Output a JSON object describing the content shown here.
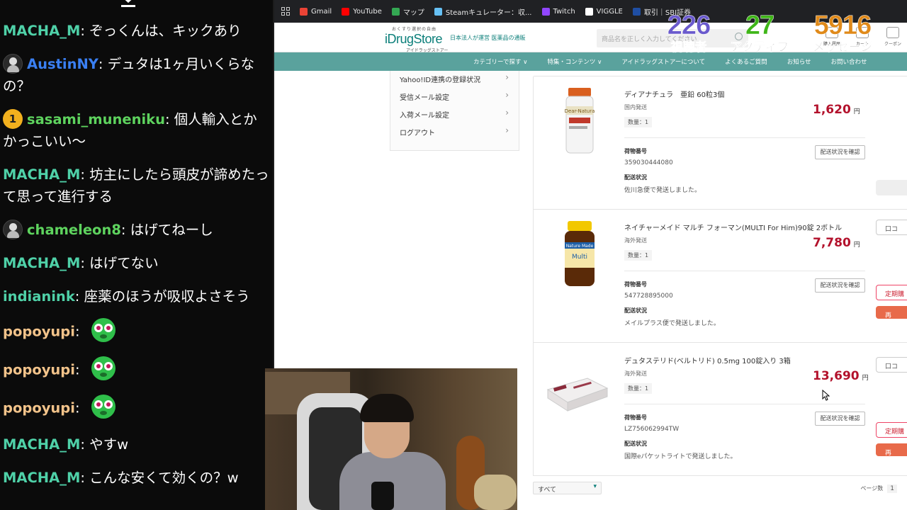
{
  "chat": {
    "messages": [
      {
        "user": "MACHA_M",
        "user_color": "#4fd1a8",
        "badge": "none",
        "text": "ぞっくんは、キックあり"
      },
      {
        "user": "AustinNY",
        "user_color": "#3a7ff2",
        "badge": "avatar",
        "text": "デュタは1ヶ月いくらなの？"
      },
      {
        "user": "sasami_muneniku",
        "user_color": "#5ed35e",
        "badge": "1",
        "text": "個人輸入とかかっこいい〜"
      },
      {
        "user": "MACHA_M",
        "user_color": "#4fd1a8",
        "badge": "none",
        "text": "坊主にしたら頭皮が諦めたって思って進行する"
      },
      {
        "user": "chameleon8",
        "user_color": "#5ed35e",
        "badge": "avatar",
        "text": "はげてねーし"
      },
      {
        "user": "MACHA_M",
        "user_color": "#4fd1a8",
        "badge": "none",
        "text": "はげてない"
      },
      {
        "user": "indianink",
        "user_color": "#4fd1a8",
        "badge": "none",
        "text": "座薬のほうが吸収よさそう"
      },
      {
        "user": "popoyupi",
        "user_color": "#f2c38a",
        "badge": "none",
        "text": "",
        "emote": "green-face-emote"
      },
      {
        "user": "popoyupi",
        "user_color": "#f2c38a",
        "badge": "none",
        "text": "",
        "emote": "green-face-emote"
      },
      {
        "user": "popoyupi",
        "user_color": "#f2c38a",
        "badge": "none",
        "text": "",
        "emote": "green-face-emote"
      },
      {
        "user": "MACHA_M",
        "user_color": "#4fd1a8",
        "badge": "none",
        "text": "やすw"
      },
      {
        "user": "MACHA_M",
        "user_color": "#4fd1a8",
        "badge": "none",
        "text": "こんな安くて効くの？w"
      }
    ],
    "separator": ": "
  },
  "bookmarks": [
    {
      "label": "Gmail",
      "color": "#ea4335"
    },
    {
      "label": "YouTube",
      "color": "#ff0000"
    },
    {
      "label": "マップ",
      "color": "#34a853"
    },
    {
      "label": "Steamキュレーター：収...",
      "color": "#66c0f4"
    },
    {
      "label": "Twitch",
      "color": "#9146ff"
    },
    {
      "label": "VIGGLE",
      "color": "#ffffff"
    },
    {
      "label": "取引｜SBI証券",
      "color": "#1f4ea3"
    }
  ],
  "site": {
    "logo_small": "おくすり選択の自由",
    "logo_main": "iDrugStore",
    "logo_jp": "アイドラッグストアー",
    "logo_tag": "日本法人が運営 医薬品の通販",
    "search_placeholder": "商品名を正しく入力してください",
    "header_icons": [
      "購入履歴",
      "カート",
      "クーポン"
    ],
    "nav": [
      "カテゴリーで探す ∨",
      "特集・コンテンツ ∨",
      "アイドラッグストアーについて",
      "よくあるご質問",
      "お知らせ",
      "お問い合わせ"
    ],
    "side_menu": [
      "Yahoo!ID連携の登録状況",
      "受信メール設定",
      "入荷メール設定",
      "ログアウト"
    ]
  },
  "orders": [
    {
      "name": "ディアナチュラ　亜鉛 60粒3個",
      "origin": "国内発送",
      "qty": "数量：1",
      "price": "1,620",
      "yen": "円",
      "tracking_label": "荷物番号",
      "tracking_no": "359030444080",
      "status_label": "配送状況",
      "status": "佐川急便で発送しました。",
      "track_btn": "配送状況を確認",
      "image": "supplement-bottle-image"
    },
    {
      "name": "ネイチャーメイド マルチ フォーマン(MULTI For Him)90錠 2ボトル",
      "origin": "海外発送",
      "qty": "数量：1",
      "price": "7,780",
      "yen": "円",
      "tracking_label": "荷物番号",
      "tracking_no": "547728895000",
      "status_label": "配送状況",
      "status": "メイルプラス便で発送しました。",
      "track_btn": "配送状況を確認",
      "side_btns": [
        "口コ",
        "定期購",
        "再"
      ],
      "image": "vitamin-bottle-image"
    },
    {
      "name": "デュタステリド(ベルトリド) 0.5mg 100錠入り 3箱",
      "origin": "海外発送",
      "qty": "数量：1",
      "price": "13,690",
      "yen": "円",
      "tracking_label": "荷物番号",
      "tracking_no": "LZ756062994TW",
      "status_label": "配送状況",
      "status": "国際eパケットライトで発送しました。",
      "track_btn": "配送状況を確認",
      "side_btns": [
        "口コ",
        "定期購",
        "再"
      ],
      "image": "medicine-box-image"
    }
  ],
  "footer": {
    "filter": "すべて",
    "pager_label": "ページ数",
    "page": "1"
  },
  "stats": [
    {
      "value": "226",
      "label": "視聴者",
      "color": "#6a5acd"
    },
    {
      "value": "27",
      "label": "アクティブ",
      "color": "#3fb618"
    },
    {
      "value": "5916",
      "label": "メッセージ",
      "color": "#e08a1a"
    }
  ]
}
